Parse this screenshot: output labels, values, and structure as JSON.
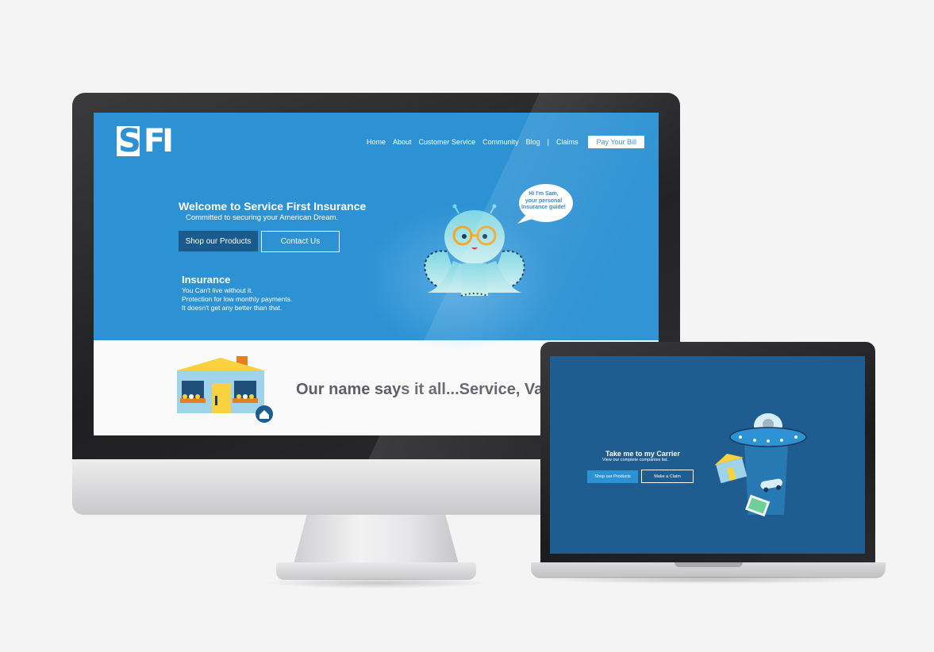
{
  "site": {
    "logo_text": "SFI",
    "nav": {
      "items": [
        "Home",
        "About",
        "Customer Service",
        "Community",
        "Blog"
      ],
      "separator": "|",
      "claims": "Claims",
      "pay_button": "Pay Your Bill"
    },
    "hero": {
      "title": "Welcome to Service First Insurance",
      "subtitle": "Committed to securing your American Dream.",
      "shop_button": "Shop our Products",
      "contact_button": "Contact Us",
      "insurance_heading": "Insurance",
      "insurance_lines": [
        "You Can't live without it.",
        "Protection for low monthly payments.",
        "It doesn't get any better than that."
      ],
      "speech_bubble": [
        "Hi I'm Sam,",
        "your personal",
        "Insurance guide!"
      ]
    },
    "tagline": "Our name says it all...Service, Value"
  },
  "laptop": {
    "title": "Take me to my Carrier",
    "subtitle": "View our complete companies list.",
    "shop_button": "Shop our Products",
    "claim_button": "Make a Claim"
  },
  "colors": {
    "hero_blue": "#2d92d3",
    "dark_button": "#1b5a8c",
    "laptop_bg": "#1f5c8f",
    "tagline_gray": "#5e6066"
  },
  "icons": [
    "home-icon",
    "octopus-mascot",
    "house-illustration",
    "ufo-illustration"
  ]
}
